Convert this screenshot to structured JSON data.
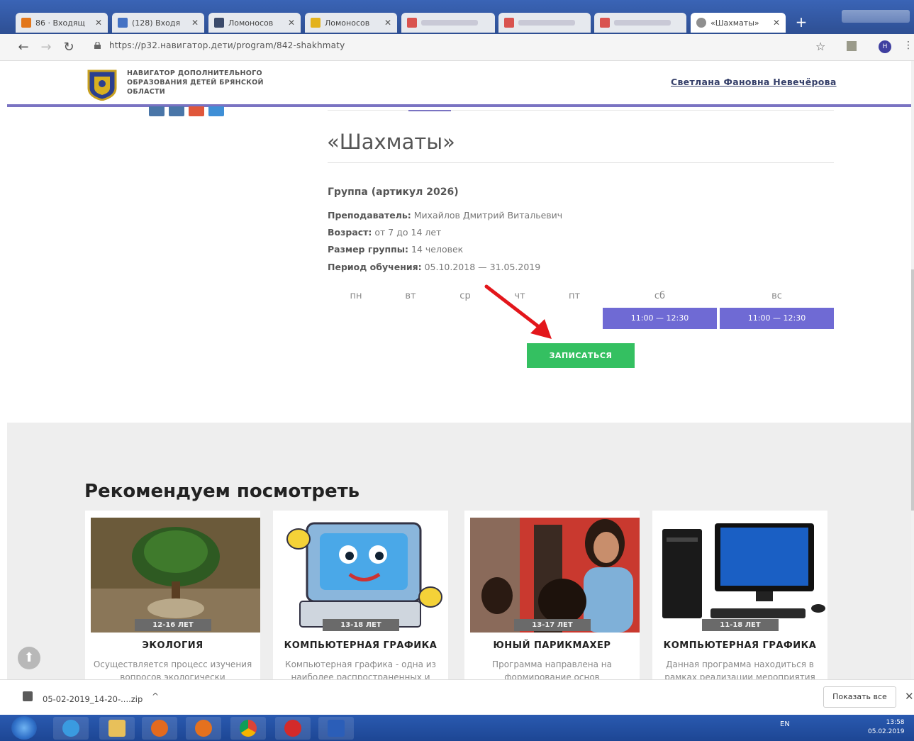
{
  "browser": {
    "tabs": [
      {
        "label": "86 · Входящ",
        "icon_color": "#e2761b",
        "blurred": false
      },
      {
        "label": "(128) Входя",
        "icon_color": "#4472c4",
        "blurred": false
      },
      {
        "label": "Ломоносов",
        "icon_color": "#3b4a6a",
        "blurred": false
      },
      {
        "label": "Ломоносов",
        "icon_color": "#e3b21c",
        "blurred": false
      },
      {
        "label": "",
        "icon_color": "#d9534f",
        "blurred": true
      },
      {
        "label": "",
        "icon_color": "#d9534f",
        "blurred": true
      },
      {
        "label": "",
        "icon_color": "#d9534f",
        "blurred": true
      },
      {
        "label": "«Шахматы»",
        "icon_color": "#8f8f8f",
        "blurred": false,
        "active": true
      }
    ],
    "url": "https://p32.навигатор.дети/program/842-shakhmaty",
    "avatar_letter": "Н"
  },
  "header": {
    "org_name": "НАВИГАТОР ДОПОЛНИТЕЛЬНОГО ОБРАЗОВАНИЯ ДЕТЕЙ БРЯНСКОЙ ОБЛАСТИ",
    "user_name": "Светлана Фановна Невечёрова"
  },
  "program": {
    "title": "«Шахматы»",
    "group_title": "Группа (артикул 2026)",
    "teacher_label": "Преподаватель:",
    "teacher_value": " Михайлов Дмитрий Витальевич",
    "age_label": "Возраст:",
    "age_value": " от 7 до 14  лет",
    "size_label": "Размер группы:",
    "size_value": " 14 человек",
    "period_label": "Период обучения:",
    "period_value": " 05.10.2018 — 31.05.2019"
  },
  "schedule": {
    "days": [
      "пн",
      "вт",
      "ср",
      "чт",
      "пт",
      "сб",
      "вс"
    ],
    "slot_sat": "11:00 — 12:30",
    "slot_sun": "11:00 — 12:30"
  },
  "signup_label": "ЗАПИСАТЬСЯ",
  "recommend": {
    "title": "Рекомендуем посмотреть",
    "cards": [
      {
        "name": "ЭКОЛОГИЯ",
        "age": "12-16 ЛЕТ",
        "desc": "Осуществляется процесс изучения вопросов экологически"
      },
      {
        "name": "КОМПЬЮТЕРНАЯ ГРАФИКА",
        "age": "13-18 ЛЕТ",
        "desc": "Компьютерная графика - одна из наиболее распространенных и"
      },
      {
        "name": "ЮНЫЙ ПАРИКМАХЕР",
        "age": "13-17 ЛЕТ",
        "desc": "Программа направлена на формирование основ"
      },
      {
        "name": "КОМПЬЮТЕРНАЯ ГРАФИКА",
        "age": "11-18 ЛЕТ",
        "desc": "Данная программа находиться в рамках реализации мероприятия"
      }
    ]
  },
  "downloads": {
    "file": "05-02-2019_14-20-....zip",
    "show_all": "Показать все"
  },
  "taskbar": {
    "lang": "EN",
    "time": "13:58",
    "date": "05.02.2019"
  },
  "colors": {
    "accent": "#7a73c2",
    "slot": "#6f6ad4",
    "signup": "#34c061",
    "arrow": "#e3161b"
  }
}
